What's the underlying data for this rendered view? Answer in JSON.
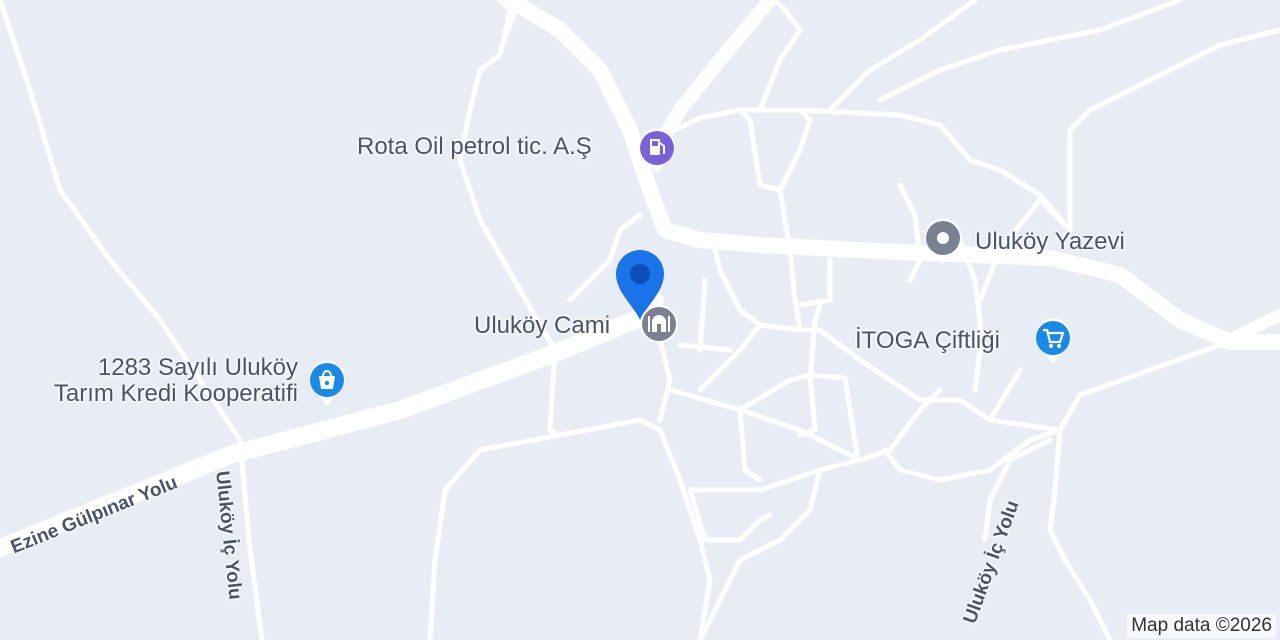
{
  "pois": [
    {
      "name": "Rota Oil petrol tic. A.Ş",
      "icon": "gas-station-icon",
      "color": "#7b61d9"
    },
    {
      "name": "Uluköy Yazevi",
      "icon": "place-icon",
      "color": "#7a8292"
    },
    {
      "name": "Uluköy Cami",
      "icon": "mosque-icon",
      "color": "#7a8292"
    },
    {
      "name": "İTOGA Çiftliği",
      "icon": "shopping-cart-icon",
      "color": "#1a8ae8"
    },
    {
      "name_line1": "1283 Sayılı Uluköy",
      "name_line2": "Tarım Kredi Kooperatifi",
      "icon": "shopping-bag-icon",
      "color": "#1a8ae8"
    }
  ],
  "roads": {
    "main_road": "Ezine Gülpınar Yolu",
    "west_road": "Uluköy İç Yolu",
    "east_road": "Uluköy İç Yolu"
  },
  "location_marker": {
    "icon": "location-pin-icon",
    "color": "#1a73e8"
  },
  "attribution": "Map data ©2026"
}
